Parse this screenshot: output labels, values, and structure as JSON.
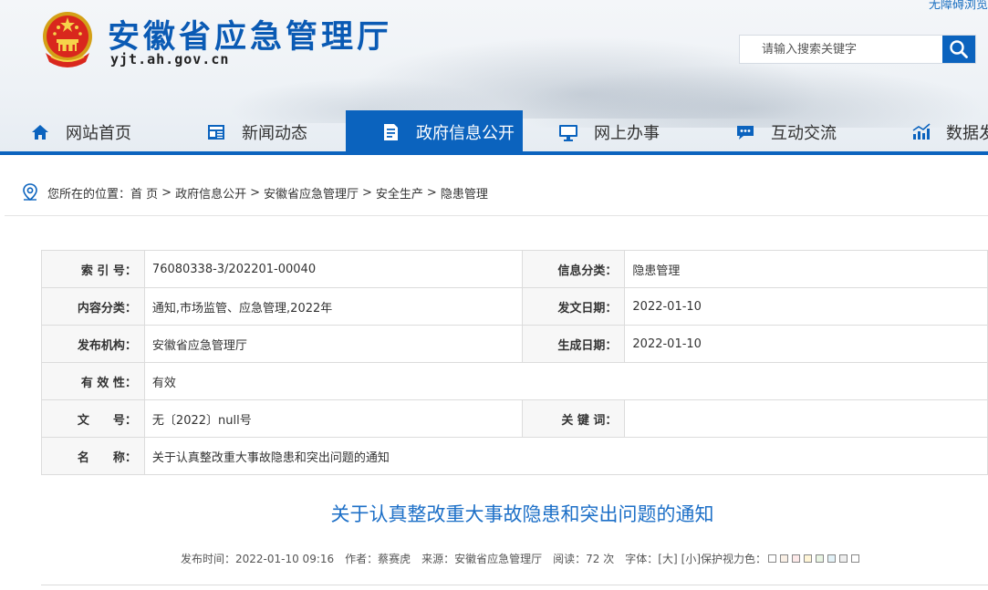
{
  "header": {
    "top_link": "无障碍浏览",
    "title": "安徽省应急管理厅",
    "url": "yjt.ah.gov.cn",
    "search_placeholder": "请输入搜索关键字",
    "emblem_icon": "national-emblem",
    "brand_color": "#0b63be"
  },
  "nav": {
    "items": [
      {
        "label": "网站首页",
        "icon": "home-icon"
      },
      {
        "label": "新闻动态",
        "icon": "news-icon"
      },
      {
        "label": "政府信息公开",
        "icon": "document-icon",
        "active": true
      },
      {
        "label": "网上办事",
        "icon": "monitor-icon"
      },
      {
        "label": "互动交流",
        "icon": "chat-icon"
      },
      {
        "label": "数据发",
        "icon": "chart-icon"
      }
    ]
  },
  "breadcrumb": {
    "prefix": "您所在的位置：",
    "items": [
      "首 页",
      "政府信息公开",
      "安徽省应急管理厅",
      "安全生产",
      "隐患管理"
    ]
  },
  "info": {
    "index_label": "索 引 号：",
    "index_value": "76080338-3/202201-00040",
    "category_label": "信息分类：",
    "category_value": "隐患管理",
    "content_label": "内容分类：",
    "content_value": "通知,市场监管、应急管理,2022年",
    "issue_date_label": "发文日期：",
    "issue_date_value": "2022-01-10",
    "publisher_label": "发布机构：",
    "publisher_value": "安徽省应急管理厅",
    "gen_date_label": "生成日期：",
    "gen_date_value": "2022-01-10",
    "validity_label": "有 效 性：",
    "validity_value": "有效",
    "docno_label": "文　　号：",
    "docno_value": "无〔2022〕null号",
    "keywords_label": "关 键 词：",
    "keywords_value": "",
    "name_label": "名　　称：",
    "name_value": "关于认真整改重大事故隐患和突出问题的通知"
  },
  "article": {
    "title": "关于认真整改重大事故隐患和突出问题的通知",
    "publish_time": "发布时间：2022-01-10 09:16",
    "author": "作者：蔡赛虎",
    "source": "来源：安徽省应急管理厅",
    "reads": "阅读：72 次",
    "font_size_label": "字体：",
    "font_large": "[大]",
    "font_small": "[小]",
    "eye_care_label": "保护视力色：",
    "eye_colors": [
      "#ffffff",
      "#faf0e6",
      "#fde9e9",
      "#fff5d6",
      "#e9f5e3",
      "#e3f2f8",
      "#eeeeee",
      "#ffffff"
    ]
  }
}
